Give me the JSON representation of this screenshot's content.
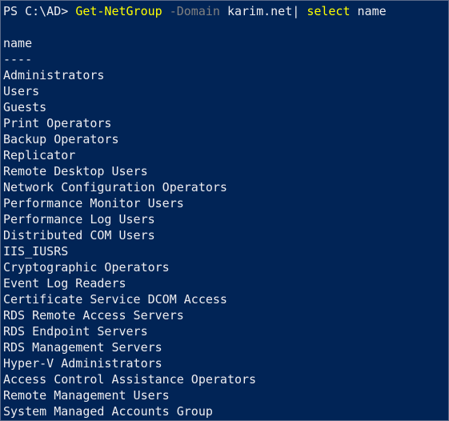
{
  "command_line": {
    "prompt": "PS C:\\AD> ",
    "cmdlet": "Get-NetGroup",
    "parameter": " -Domain ",
    "argument": "karim.net",
    "pipe": "| ",
    "select_cmd": "select",
    "select_arg": " name"
  },
  "output": {
    "header": "name",
    "underline": "----",
    "rows": [
      "Administrators",
      "Users",
      "Guests",
      "Print Operators",
      "Backup Operators",
      "Replicator",
      "Remote Desktop Users",
      "Network Configuration Operators",
      "Performance Monitor Users",
      "Performance Log Users",
      "Distributed COM Users",
      "IIS_IUSRS",
      "Cryptographic Operators",
      "Event Log Readers",
      "Certificate Service DCOM Access",
      "RDS Remote Access Servers",
      "RDS Endpoint Servers",
      "RDS Management Servers",
      "Hyper-V Administrators",
      "Access Control Assistance Operators",
      "Remote Management Users",
      "System Managed Accounts Group"
    ]
  },
  "colors": {
    "background": "#012456",
    "text": "#eeedf0",
    "cmdlet": "#ffff00",
    "parameter": "#808080"
  }
}
